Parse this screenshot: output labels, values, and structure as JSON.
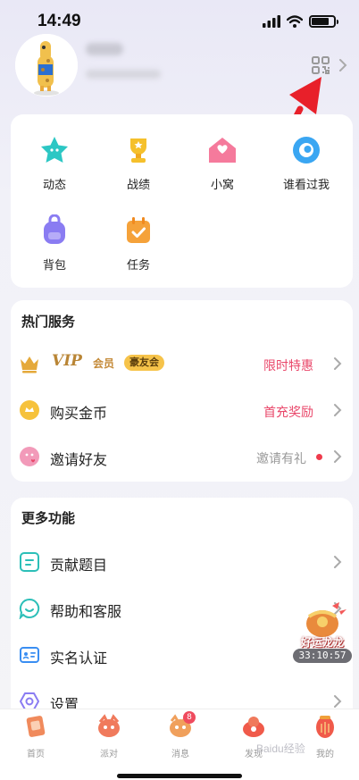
{
  "status_bar": {
    "time": "14:49"
  },
  "profile": {
    "qr_icon": "qr-code-icon"
  },
  "features": [
    {
      "label": "动态",
      "icon": "star-icon",
      "color": "#2cc7c4"
    },
    {
      "label": "战绩",
      "icon": "trophy-icon",
      "color": "#f5c02c"
    },
    {
      "label": "小窝",
      "icon": "home-icon",
      "color": "#f57a9c"
    },
    {
      "label": "谁看过我",
      "icon": "eye-icon",
      "color": "#3aa6f2"
    },
    {
      "label": "背包",
      "icon": "backpack-icon",
      "color": "#8a7cf2"
    },
    {
      "label": "任务",
      "icon": "calendar-icon",
      "color": "#f5a23a"
    }
  ],
  "hot_services": {
    "title": "热门服务",
    "vip": {
      "text": "VIP",
      "sub": "会员",
      "badge": "豪友会",
      "right": "限时特惠"
    },
    "buy_coins": {
      "label": "购买金币",
      "right": "首充奖励"
    },
    "invite": {
      "label": "邀请好友",
      "right": "邀请有礼"
    }
  },
  "more_functions": {
    "title": "更多功能",
    "items": [
      {
        "label": "贡献题目",
        "icon": "question-list-icon"
      },
      {
        "label": "帮助和客服",
        "icon": "chat-service-icon"
      },
      {
        "label": "实名认证",
        "icon": "id-card-icon"
      },
      {
        "label": "设置",
        "icon": "settings-icon"
      }
    ]
  },
  "promo": {
    "title": "好运龙龙",
    "timer": "33:10:57"
  },
  "tabbar": [
    {
      "label": "首页"
    },
    {
      "label": "派对"
    },
    {
      "label": "消息",
      "badge": "8"
    },
    {
      "label": "发现"
    },
    {
      "label": "我的"
    }
  ],
  "watermark": "Baidu经验",
  "colors": {
    "accent_red": "#e9476a",
    "gold": "#b98535",
    "annotation_arrow": "#e8202a"
  }
}
